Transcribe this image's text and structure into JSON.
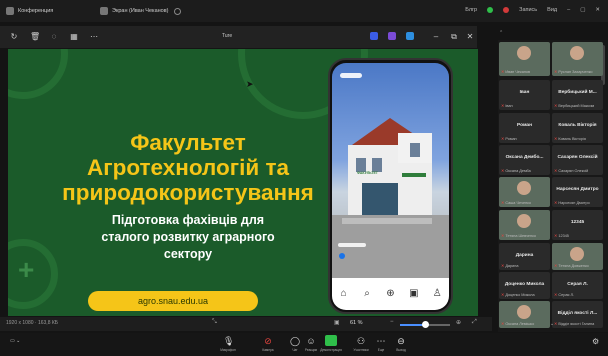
{
  "window": {
    "tabs": [
      {
        "label": "Конференция"
      },
      {
        "label": "Экран (Иван Чеканов)"
      }
    ],
    "status": {
      "conn": "Блгр",
      "rec": "Запись",
      "view": "Вид"
    }
  },
  "share_toolbar": {
    "title": "Ture"
  },
  "slide": {
    "title_lines": [
      "Факультет",
      "Агротехнологій та",
      "природокористування"
    ],
    "subtitle_lines": [
      "Підготовка фахівців для",
      "сталого розвитку аграрного",
      "сектору"
    ],
    "link": "agro.snau.edu.ua",
    "phone_sign": "ФАКУЛЬТЕТ",
    "colors": {
      "bg": "#1b5b2a",
      "accent": "#f5c518"
    }
  },
  "statusbar": {
    "left": "1920 x 1080 · 163,8 КБ",
    "zoom": "61 %",
    "zoom_fraction": 0.5
  },
  "participants": [
    {
      "name": "",
      "label": "Иван Чеканов",
      "video": true
    },
    {
      "name": "",
      "label": "Руслан Захарченко",
      "video": true
    },
    {
      "name": "Іван",
      "label": "Іван",
      "video": false
    },
    {
      "name": "Вербицький М...",
      "label": "Вербицький Максим",
      "video": false
    },
    {
      "name": "Роман",
      "label": "Роман",
      "video": false
    },
    {
      "name": "Коваль Вікторія",
      "label": "Коваль Вікторія",
      "video": false
    },
    {
      "name": "Оксана Дембо...",
      "label": "Оксана Демба",
      "video": false
    },
    {
      "name": "Сахарян Олексій",
      "label": "Сахарян Олексій",
      "video": false
    },
    {
      "name": "",
      "label": "Сашa Чеченко",
      "video": true
    },
    {
      "name": "Нарсесян Дмитро",
      "label": "Нарсесян Дмитро",
      "video": false
    },
    {
      "name": "",
      "label": "Тетяна Шевченко",
      "video": true
    },
    {
      "name": "12345",
      "label": "12345",
      "video": false
    },
    {
      "name": "Дарина",
      "label": "Дарина",
      "video": false
    },
    {
      "name": "",
      "label": "Тетяна Довженко",
      "video": true
    },
    {
      "name": "Доценко Микола",
      "label": "Доценко Микола",
      "video": false
    },
    {
      "name": "Серая Л.",
      "label": "Серая Л.",
      "video": false
    },
    {
      "name": "",
      "label": "Оксана Лемішко",
      "video": true
    },
    {
      "name": "Відділ якості Л...",
      "label": "Відділ якості Галина",
      "video": false
    }
  ],
  "meeting_toolbar": {
    "items": [
      {
        "label": "Микрофон"
      },
      {
        "label": "Камера"
      },
      {
        "label": "Чат"
      },
      {
        "label": "Реакции"
      },
      {
        "label": "Демонстрация"
      },
      {
        "label": "Участники"
      },
      {
        "label": "Еще"
      },
      {
        "label": "Выход"
      }
    ]
  }
}
